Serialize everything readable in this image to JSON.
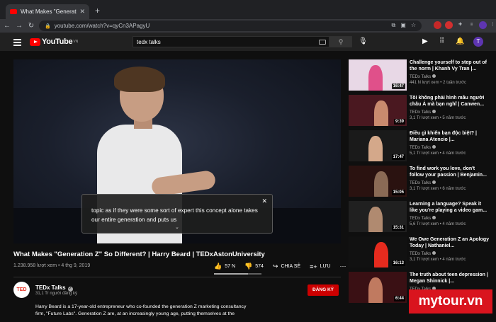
{
  "browser": {
    "tab_title": "What Makes \"Generation Z...",
    "url": "youtube.com/watch?v=qyCn3APagyU"
  },
  "youtube": {
    "logo_text": "YouTube",
    "region": "VN",
    "search_query": "tedx talks",
    "user_initial": "T"
  },
  "player": {
    "caption": "topic as if they were some sort of expert this concept alone takes our entire generation and puts us"
  },
  "video": {
    "title": "What Makes \"Generation Z\" So Different? | Harry Beard | TEDxAstonUniversity",
    "meta": "1.238.958 lượt xem • 4 thg 9, 2019",
    "likes": "57 N",
    "dislikes": "574",
    "share_label": "CHIA SẺ",
    "save_label": "LƯU",
    "like_ratio": 0.72
  },
  "channel": {
    "avatar_text": "TED",
    "name": "TEDx Talks",
    "subscribers": "31,1 Tr người đăng ký",
    "subscribe_label": "ĐĂNG KÝ",
    "description": "Harry Beard is a 17-year-old entrepreneur who co-founded the generation Z marketing consultancy firm, \"Future Labs\". Generation Z are, at an increasingly young age, putting themselves at the"
  },
  "sidebar": {
    "items": [
      {
        "title": "Challenge yourself to step out of the norm | Khanh Vy Tran |...",
        "channel": "TEDx Talks",
        "views": "441 N lượt xem • 2 tuần trước",
        "duration": "16:47",
        "bg": "#e8d8e6",
        "fig": "#e0508a"
      },
      {
        "title": "Tôi không phải hình mẫu người châu Á mà bạn nghĩ | Canwen...",
        "channel": "TEDx Talks",
        "views": "3,1 Tr lượt xem • 5 năm trước",
        "duration": "9:39",
        "bg": "#4a1820",
        "fig": "#c98a6e"
      },
      {
        "title": "Điều gì khiến bạn độc biệt? | Mariana Atencio |...",
        "channel": "TEDx Talks",
        "views": "5,1 Tr lượt xem • 4 năm trước",
        "duration": "17:47",
        "bg": "#1a1a1a",
        "fig": "#d4a88a"
      },
      {
        "title": "To find work you love, don't follow your passion | Benjamin...",
        "channel": "TEDx Talks",
        "views": "3,1 Tr lượt xem • 6 năm trước",
        "duration": "15:05",
        "bg": "#2a1210",
        "fig": "#8a6a55"
      },
      {
        "title": "Learning a language? Speak it like you're playing a video gam...",
        "channel": "TEDx Talks",
        "views": "5,6 Tr lượt xem • 4 năm trước",
        "duration": "15:31",
        "bg": "#202020",
        "fig": "#b08a70"
      },
      {
        "title": "We Owe Generation Z an Apology Today | Nathaniel...",
        "channel": "TEDx Talks",
        "views": "3,1 Tr lượt xem • 4 năm trước",
        "duration": "16:13",
        "bg": "#111111",
        "fig": "#e62b1e"
      },
      {
        "title": "The truth about teen depression | Megan Shinnick |...",
        "channel": "TEDx Talks",
        "views": "",
        "duration": "6:44",
        "bg": "#3a1014",
        "fig": "#c07a60"
      }
    ]
  },
  "watermark": "mytour.vn"
}
